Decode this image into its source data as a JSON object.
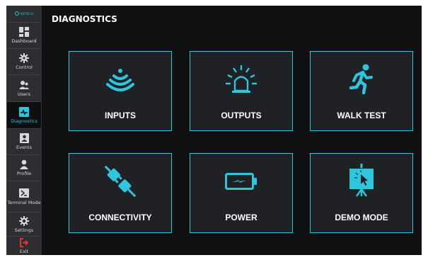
{
  "brand": {
    "name": "ARITECH"
  },
  "colors": {
    "accent": "#2fc6dd",
    "exit": "#e2342f",
    "sidebar": "#2c2e31",
    "background": "#0f1012",
    "tile": "#1f2125"
  },
  "page": {
    "title": "DIAGNOSTICS"
  },
  "sidebar": {
    "items": [
      {
        "label": "Dashboard",
        "icon": "dashboard-icon",
        "active": false
      },
      {
        "label": "Control",
        "icon": "gear-control-icon",
        "active": false
      },
      {
        "label": "Users",
        "icon": "users-icon",
        "active": false
      },
      {
        "label": "Diagnostics",
        "icon": "diagnostics-icon",
        "active": true
      },
      {
        "label": "Events",
        "icon": "events-icon",
        "active": false
      },
      {
        "label": "Profile",
        "icon": "profile-icon",
        "active": false
      },
      {
        "label": "Terminal Mode",
        "icon": "terminal-icon",
        "active": false
      },
      {
        "label": "Settings",
        "icon": "settings-icon",
        "active": false
      },
      {
        "label": "Exit",
        "icon": "exit-icon",
        "active": false
      }
    ]
  },
  "tiles": [
    {
      "label": "INPUTS",
      "icon": "signal-waves-icon"
    },
    {
      "label": "OUTPUTS",
      "icon": "alarm-beacon-icon"
    },
    {
      "label": "WALK TEST",
      "icon": "running-person-icon"
    },
    {
      "label": "CONNECTIVITY",
      "icon": "plug-connection-icon"
    },
    {
      "label": "POWER",
      "icon": "battery-charging-icon"
    },
    {
      "label": "DEMO MODE",
      "icon": "presentation-screen-icon"
    }
  ]
}
